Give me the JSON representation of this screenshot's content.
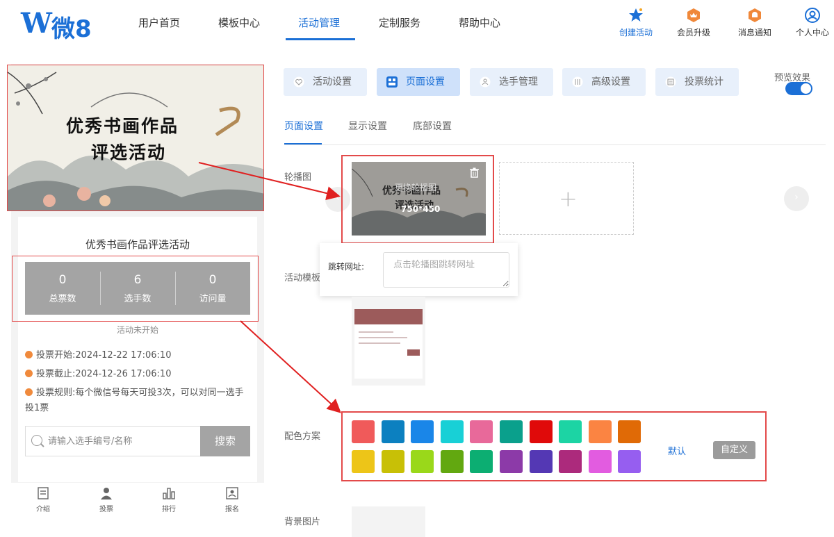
{
  "header": {
    "logo_text": "微8",
    "logo_letter": "W",
    "nav": [
      "用户首页",
      "模板中心",
      "活动管理",
      "定制服务",
      "帮助中心"
    ],
    "nav_active": "活动管理",
    "actions": [
      {
        "label": "创建活动",
        "icon": "star-icon"
      },
      {
        "label": "会员升级",
        "icon": "crown-badge-icon"
      },
      {
        "label": "消息通知",
        "icon": "bell-badge-icon"
      },
      {
        "label": "个人中心",
        "icon": "user-icon"
      }
    ]
  },
  "preview": {
    "banner_line1": "优秀书画作品",
    "banner_line2": "评选活动",
    "activity_title": "优秀书画作品评选活动",
    "stats": [
      {
        "value": "0",
        "label": "总票数"
      },
      {
        "value": "6",
        "label": "选手数"
      },
      {
        "value": "0",
        "label": "访问量"
      }
    ],
    "status": "活动未开始",
    "vote_start_label": "投票开始:",
    "vote_start": "2024-12-22 17:06:10",
    "vote_end_label": "投票截止:",
    "vote_end": "2024-12-26 17:06:10",
    "vote_rule_label": "投票规则:",
    "vote_rule": "每个微信号每天可投3次，可以对同一选手投1票",
    "search_placeholder": "请输入选手编号/名称",
    "search_button": "搜索",
    "tabbar": [
      "介绍",
      "投票",
      "排行",
      "报名"
    ]
  },
  "settings": {
    "top_tabs": [
      "活动设置",
      "页面设置",
      "选手管理",
      "高级设置",
      "投票统计"
    ],
    "top_tab_active": "页面设置",
    "preview_toggle_label": "预览效果",
    "preview_toggle_on": true,
    "sub_tabs": [
      "页面设置",
      "显示设置",
      "底部设置"
    ],
    "sub_tab_active": "页面设置",
    "carousel_label": "轮播图",
    "carousel_hint": "更换轮播图",
    "carousel_size": "750*450",
    "carousel_add": "+",
    "url_label": "跳转网址:",
    "url_placeholder": "点击轮播图跳转网址",
    "template_label": "活动模板",
    "color_label": "配色方案",
    "colors_row1": [
      "#f05a5a",
      "#0c80c0",
      "#1a86e8",
      "#18d0d6",
      "#e8699a",
      "#0aa08c",
      "#e00a0a",
      "#1cd4a4",
      "#fb8442",
      "#e06a06"
    ],
    "colors_row2": [
      "#edc518",
      "#c8c006",
      "#9ad81a",
      "#62a810",
      "#0cae72",
      "#8c3aa8",
      "#5438b4",
      "#ac2a7c",
      "#e25ce0",
      "#965ef0"
    ],
    "default_link": "默认",
    "custom_button": "自定义",
    "bg_label": "背景图片"
  }
}
